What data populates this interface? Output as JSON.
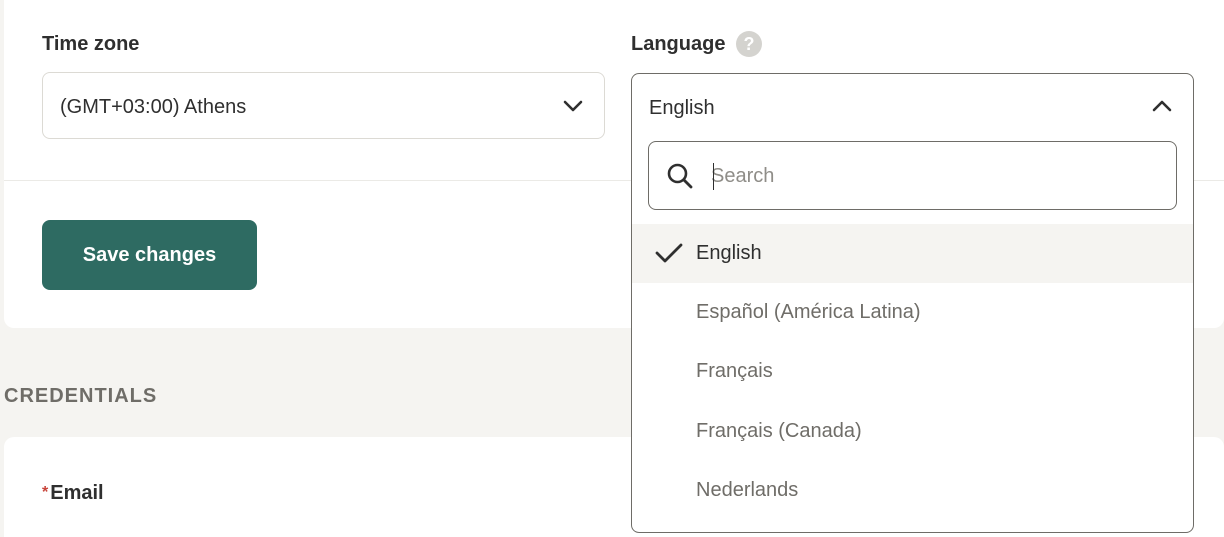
{
  "timezone": {
    "label": "Time zone",
    "value": "(GMT+03:00) Athens"
  },
  "language": {
    "label": "Language",
    "help_icon": "?",
    "value": "English",
    "search_placeholder": "Search",
    "options": [
      {
        "label": "English",
        "selected": true
      },
      {
        "label": "Español (América Latina)",
        "selected": false
      },
      {
        "label": "Français",
        "selected": false
      },
      {
        "label": "Français (Canada)",
        "selected": false
      },
      {
        "label": "Nederlands",
        "selected": false
      }
    ]
  },
  "actions": {
    "save_label": "Save changes"
  },
  "credentials": {
    "section_title": "CREDENTIALS",
    "email_required_mark": "*",
    "email_label": "Email"
  },
  "icons": {
    "dropdown_closed": "chevron-down-icon",
    "dropdown_open": "chevron-up-icon",
    "search": "search-icon",
    "selected": "check-icon",
    "help": "help-icon"
  },
  "colors": {
    "page_background": "#f5f4f1",
    "card_background": "#ffffff",
    "primary_button": "#2e6b62",
    "text_primary": "#2f2f2f",
    "text_muted": "#6f6d68",
    "required": "#c8443a",
    "selected_row": "#f5f4f1"
  }
}
